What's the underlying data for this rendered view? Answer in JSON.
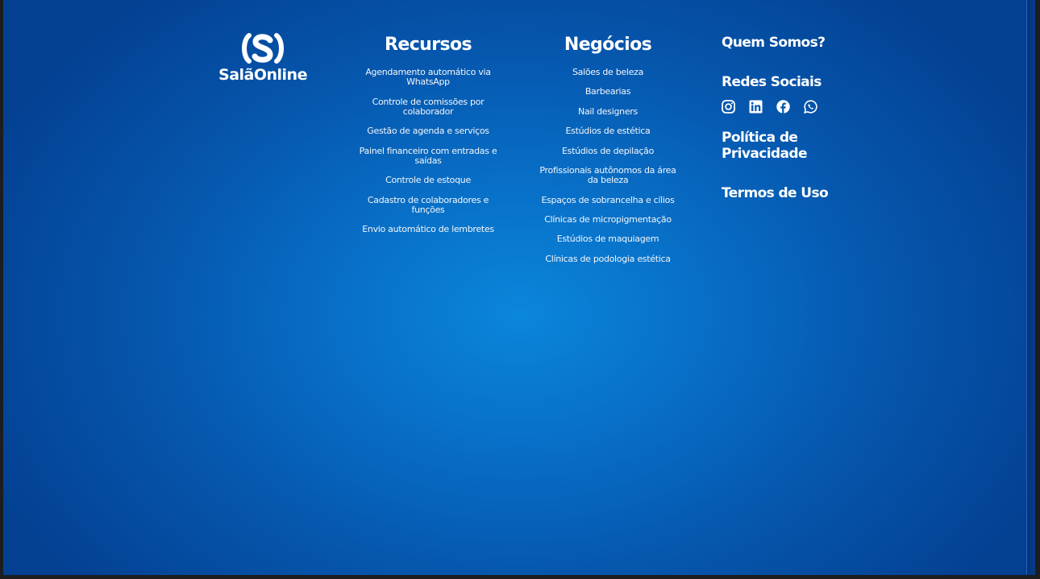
{
  "brand": {
    "logo_text": "SalãOnline"
  },
  "recursos": {
    "title": "Recursos",
    "items": [
      "Agendamento automático via WhatsApp",
      "Controle de comissões por colaborador",
      "Gestão de agenda e serviços",
      "Painel financeiro com entradas e saídas",
      "Controle de estoque",
      "Cadastro de colaboradores e funções",
      "Envio automático de lembretes"
    ]
  },
  "negocios": {
    "title": "Negócios",
    "items": [
      "Salões de beleza",
      "Barbearias",
      "Nail designers",
      "Estúdios de estética",
      "Estúdios de depilação",
      "Profissionais autônomos da área da beleza",
      "Espaços de sobrancelha e cílios",
      "Clínicas de micropigmentação",
      "Estúdios de maquiagem",
      "Clínicas de podologia estética"
    ]
  },
  "links": {
    "quem_somos": "Quem Somos?",
    "redes_sociais": "Redes Sociais",
    "politica": "Política de Privacidade",
    "termos": "Termos de Uso"
  },
  "social_icons": [
    "instagram-icon",
    "linkedin-icon",
    "facebook-icon",
    "whatsapp-icon"
  ],
  "colors": {
    "background_center": "#0a86da",
    "background_edge": "#034092",
    "text": "#ffffff"
  }
}
